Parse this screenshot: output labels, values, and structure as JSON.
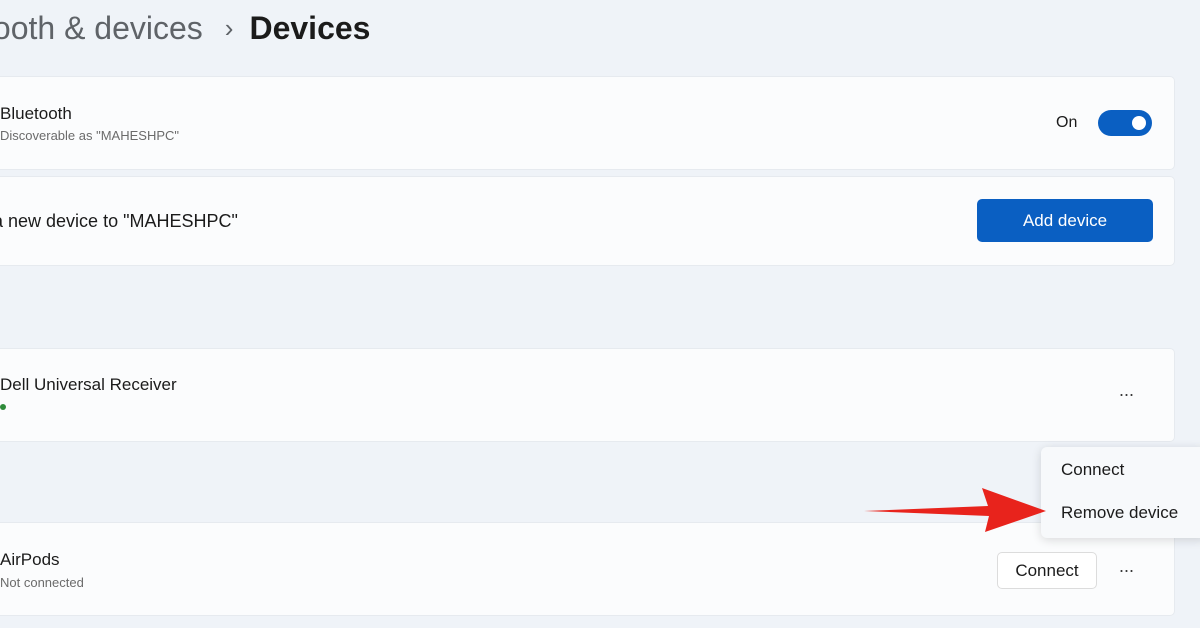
{
  "breadcrumb": {
    "parent": "tooth & devices",
    "separator": "›",
    "current": "Devices"
  },
  "bluetooth": {
    "title": "Bluetooth",
    "subtitle": "Discoverable as \"MAHESHPC\"",
    "toggle_label": "On",
    "toggle_state": "on"
  },
  "add_device_row": {
    "title": "ct a new device to \"MAHESHPC\"",
    "button_label": "Add device"
  },
  "devices": [
    {
      "name": "Dell Universal Receiver",
      "status": "connected",
      "more_label": "···"
    },
    {
      "name": "AirPods",
      "subtitle": "Not connected",
      "connect_label": "Connect",
      "more_label": "···"
    }
  ],
  "context_menu": {
    "items": [
      "Connect",
      "Remove device"
    ]
  },
  "colors": {
    "accent": "#0a5fc2",
    "annotation_arrow": "#e8231c",
    "status_connected": "#2e8b3a",
    "background": "#eff3f8",
    "card": "#fbfcfd"
  }
}
